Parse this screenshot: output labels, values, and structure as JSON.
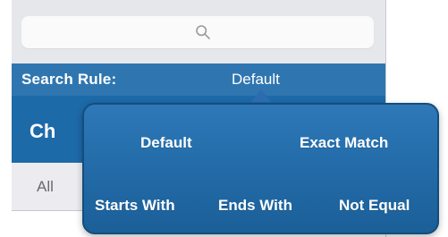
{
  "search": {
    "icon": "search-icon",
    "placeholder": ""
  },
  "search_rule": {
    "label": "Search Rule:",
    "value": "Default"
  },
  "title_band": {
    "text": "Ch"
  },
  "tab_row": {
    "label": "All"
  },
  "popover": {
    "options": [
      "Default",
      "Exact Match",
      "Starts With",
      "Ends With",
      "Not Equal"
    ]
  },
  "colors": {
    "bar_blue": "#2f76b1",
    "band_blue": "#1d6aa9",
    "popover_blue": "#236ca9",
    "text_white": "#ffffff"
  }
}
